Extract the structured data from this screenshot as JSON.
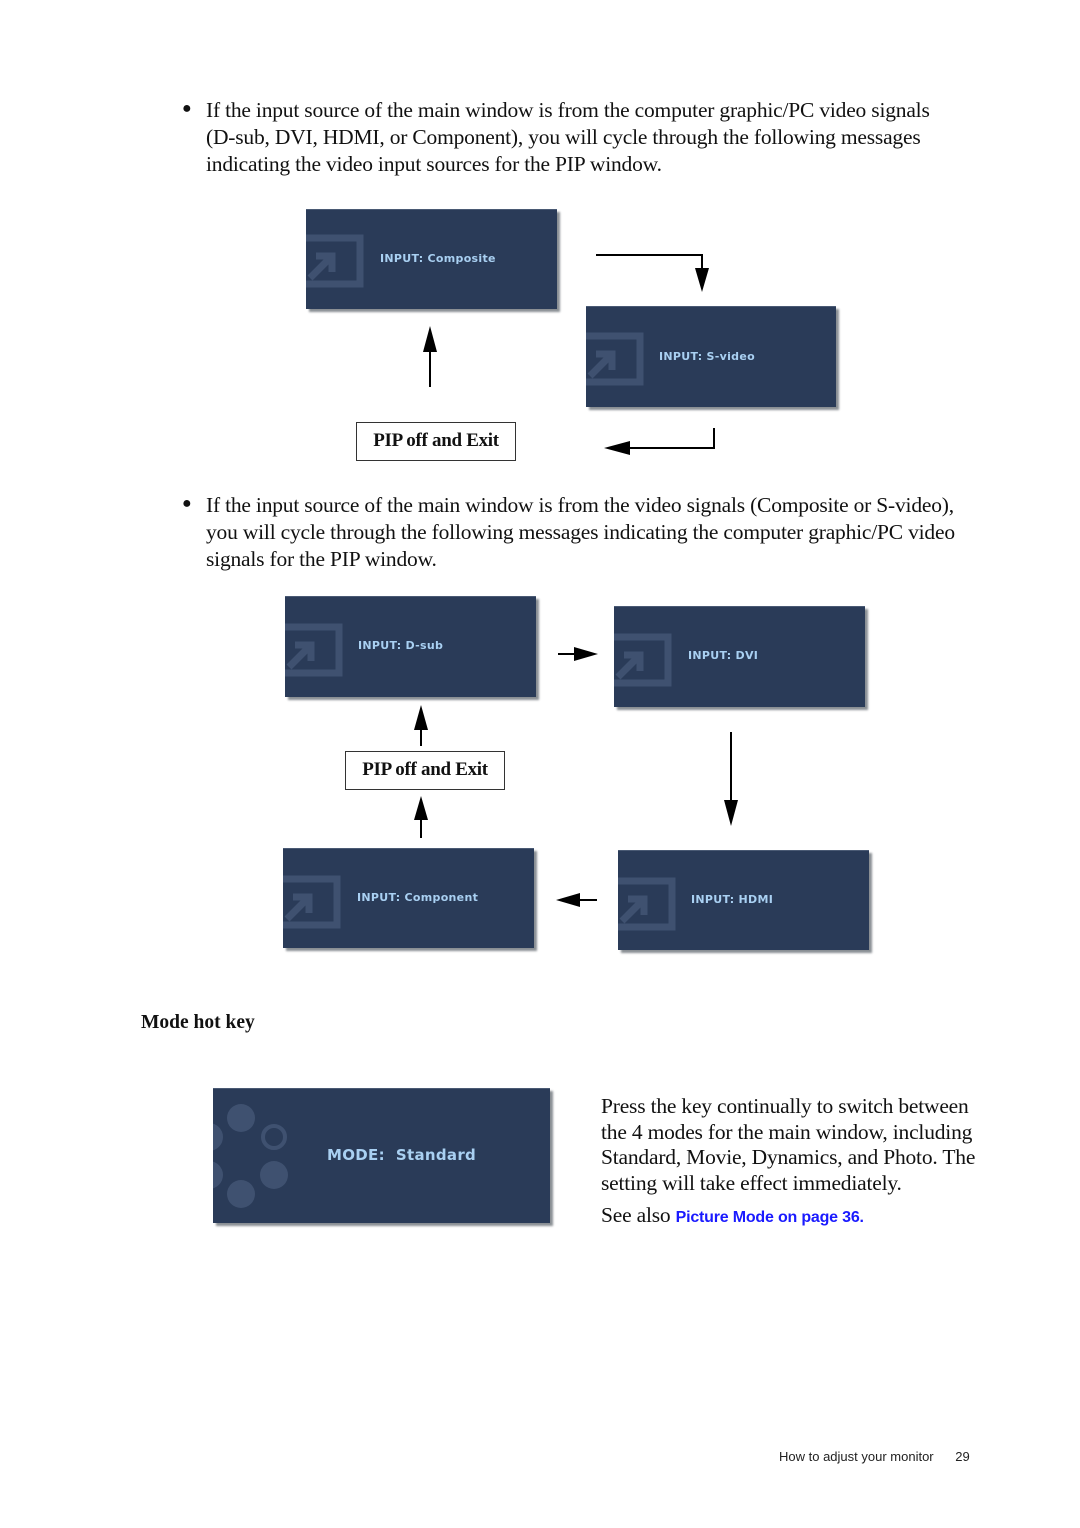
{
  "section1": {
    "bullet_text_lines": [
      "If the input source of the main window is from the computer graphic/PC video signals",
      "(D-sub, DVI, HDMI, or Component), you will cycle through the following messages",
      "indicating the video input sources for the PIP window."
    ],
    "osd": [
      "INPUT: Composite",
      "INPUT: S-video"
    ],
    "pip_exit": "PIP off and Exit"
  },
  "section2": {
    "bullet_text_lines": [
      "If the input source of the main window is from the video signals (Composite or S-video),",
      "you will cycle through the following messages indicating the computer graphic/PC video",
      "signals for the PIP window."
    ],
    "osd": [
      "INPUT: D-sub",
      "INPUT: DVI",
      "INPUT: HDMI",
      "INPUT: Component"
    ],
    "pip_exit": "PIP off and Exit"
  },
  "mode_hot_key": {
    "heading": "Mode hot key",
    "osd_label": "MODE:",
    "osd_value": "Standard",
    "description_lines": [
      "Press the key continually to switch between",
      "the 4 modes for the main window, including",
      "Standard, Movie, Dynamics, and Photo. The",
      "setting will take effect immediately."
    ],
    "see_also_prefix": "See also ",
    "see_also_link": "Picture Mode on page 36."
  },
  "footer": {
    "section_title": "How to adjust your monitor",
    "page_number": "29"
  },
  "colors": {
    "osd_background": "#2a3b58",
    "osd_text": "#a9d0f2",
    "link": "#1a1aff"
  }
}
